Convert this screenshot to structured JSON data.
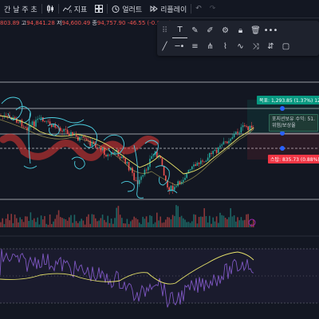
{
  "toolbar": {
    "interval_fragment": "간 날 주 초",
    "indicators_label": "지표",
    "alert_label": "얼러트",
    "replay_label": "리플레이"
  },
  "ohlc": {
    "open_frag": "803.89",
    "high_label": "고",
    "high_value": "94,841.28",
    "low_label": "저",
    "low_value": "94,600.49",
    "close_label": "종",
    "close_value": "94,757.90",
    "change": "-46.55 (-0.05%)"
  },
  "position": {
    "take_profit": "목표: 1,293.85 (1.37%) 12",
    "info_line1": "포지션보유 수익: 51.",
    "info_line2": "위험/보상율",
    "stop_loss": "스탑: 835.73 (0.88%) 8"
  },
  "colors": {
    "background": "#131722",
    "candle_up": "#26a69a",
    "candle_down": "#ef5350",
    "drawing_cyan": "#4dd0e1",
    "drawing_red": "#e53935",
    "ma_yellow": "#e6e26a",
    "osc_purple": "#7e57c2",
    "take_profit_green": "#089981",
    "stop_loss_red": "#f23645"
  },
  "drawing_tools": [
    "text-icon",
    "brush-icon",
    "pen-icon",
    "eye-settings-icon",
    "lock-icon",
    "trash-icon",
    "more-icon",
    "line-icon",
    "horizontal-ray-icon",
    "lines-icon",
    "pitchfork-icon",
    "zigzag-icon",
    "pattern-icon",
    "path-icon",
    "position-icon",
    "rectangle-icon"
  ]
}
